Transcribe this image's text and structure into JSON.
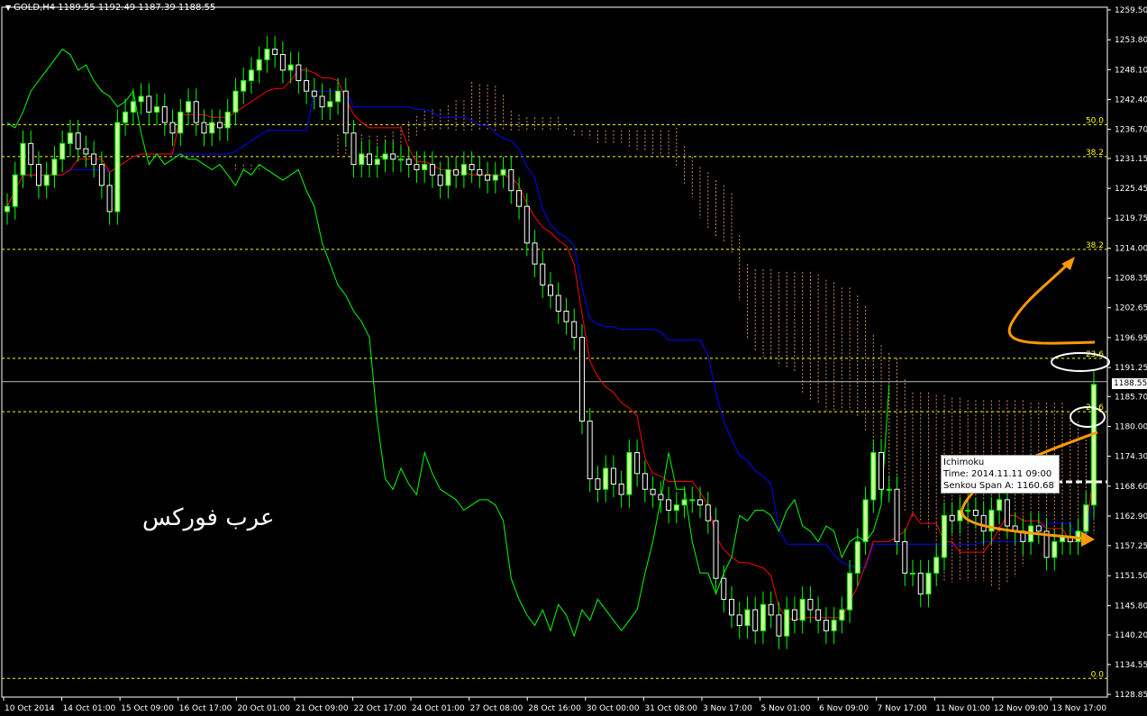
{
  "header": {
    "title": "GOLD,H4 1189.55 1192.49 1187.39 1188.55",
    "symbol": "GOLD",
    "timeframe": "H4",
    "ohlc": {
      "open": 1189.55,
      "high": 1192.49,
      "low": 1187.39,
      "close": 1188.55
    }
  },
  "watermark": "عرب فوركس",
  "tooltip": {
    "line1": "Ichimoku",
    "line2": "Time: 2014.11.11 09:00",
    "line3": "Senkou Span A: 1160.68"
  },
  "current_price_label": "1188.55",
  "colors": {
    "background": "#000000",
    "bull_candle": "#CCFF99",
    "bear_candle": "#FFFFFF",
    "wick": "#00FF00",
    "tenkan": "#FF0000",
    "kijun": "#0000FF",
    "chikou": "#00FF00",
    "kumo": "#F4A460",
    "fib_level": "#FFFF00",
    "arrow": "#FF9900"
  },
  "chart_data": {
    "type": "candlestick",
    "y_ticks": [
      "1259.50",
      "1253.80",
      "1248.10",
      "1242.40",
      "1236.70",
      "1231.15",
      "1225.45",
      "1219.75",
      "1214.00",
      "1208.35",
      "1202.65",
      "1196.95",
      "1191.25",
      "1185.70",
      "1180.00",
      "1174.30",
      "1168.60",
      "1162.90",
      "1157.25",
      "1151.50",
      "1145.80",
      "1140.20",
      "1134.55",
      "1128.85"
    ],
    "x_ticks": [
      "10 Oct 2014",
      "14 Oct 01:00",
      "15 Oct 09:00",
      "16 Oct 17:00",
      "20 Oct 01:00",
      "21 Oct 09:00",
      "22 Oct 17:00",
      "24 Oct 01:00",
      "27 Oct 08:00",
      "28 Oct 16:00",
      "30 Oct 00:00",
      "31 Oct 08:00",
      "3 Nov 17:00",
      "5 Nov 01:00",
      "6 Nov 09:00",
      "7 Nov 17:00",
      "11 Nov 01:00",
      "12 Nov 09:00",
      "13 Nov 17:00"
    ],
    "ylim": [
      1128.85,
      1259.5
    ],
    "fib_levels": [
      {
        "label": "50.0",
        "price": 1237.6
      },
      {
        "label": "38.2",
        "price": 1231.5
      },
      {
        "label": "38.2",
        "price": 1213.8
      },
      {
        "label": "23.6",
        "price": 1193.0
      },
      {
        "label": "23.6",
        "price": 1182.8
      },
      {
        "label": "0.0",
        "price": 1131.9
      }
    ],
    "current_price": 1188.55,
    "closes": [
      1222,
      1228,
      1234,
      1230,
      1226,
      1228,
      1231,
      1234,
      1236,
      1233,
      1232,
      1230,
      1226,
      1221,
      1238,
      1240,
      1242,
      1243,
      1240,
      1241,
      1238,
      1236,
      1240,
      1242,
      1238,
      1236,
      1238,
      1237,
      1240,
      1244,
      1246,
      1248,
      1250,
      1252,
      1251,
      1248,
      1249,
      1246,
      1244,
      1243,
      1241,
      1242,
      1244,
      1236,
      1230,
      1232,
      1230,
      1231,
      1232,
      1231,
      1231,
      1230,
      1229,
      1230,
      1228,
      1226,
      1229,
      1228,
      1230,
      1229,
      1228,
      1227,
      1228,
      1229,
      1225,
      1222,
      1215,
      1211,
      1207,
      1205,
      1202,
      1200,
      1197,
      1181,
      1170,
      1168,
      1172,
      1169,
      1167,
      1175,
      1171,
      1168,
      1167,
      1166,
      1164,
      1165,
      1166,
      1166,
      1165,
      1162,
      1151,
      1147,
      1144,
      1142,
      1145,
      1141,
      1146,
      1144,
      1140,
      1145,
      1143,
      1147,
      1145,
      1143,
      1141,
      1143,
      1145,
      1152,
      1158,
      1166,
      1175,
      1168,
      1168,
      1158,
      1152,
      1152,
      1148,
      1152,
      1155,
      1163,
      1162,
      1164,
      1164,
      1163,
      1160,
      1164,
      1166,
      1161,
      1160,
      1158,
      1161,
      1160,
      1155,
      1158,
      1159,
      1158,
      1160,
      1165,
      1188
    ]
  }
}
